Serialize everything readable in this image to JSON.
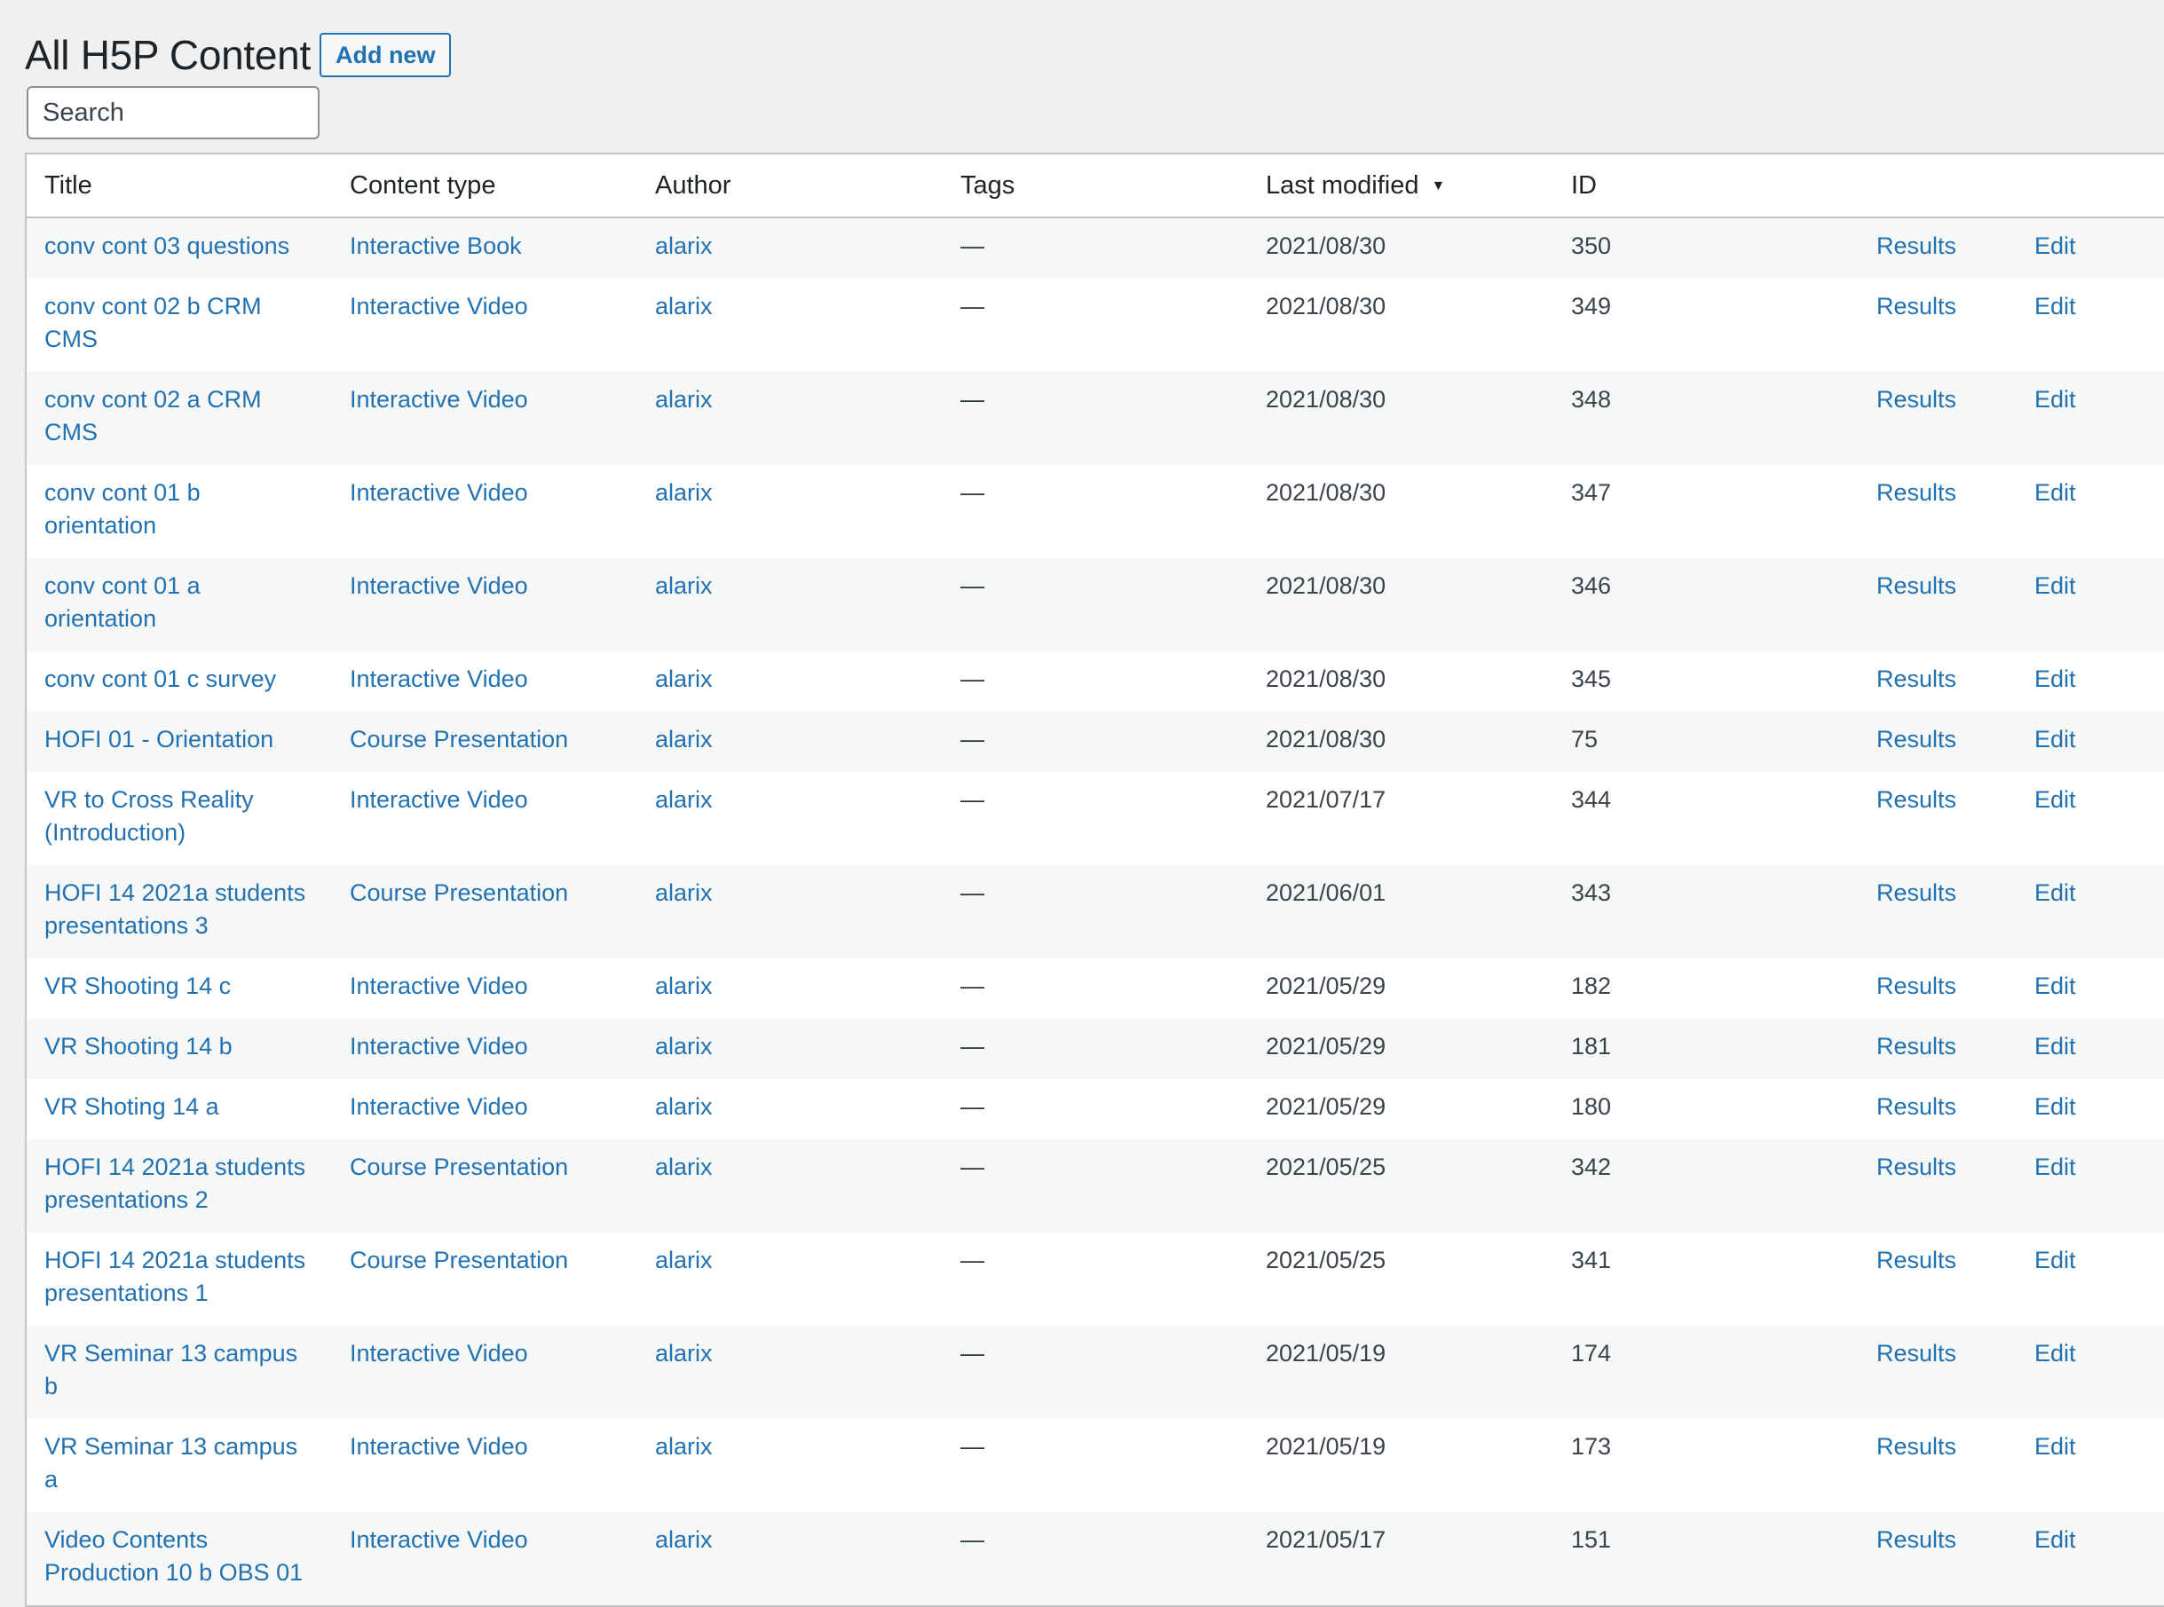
{
  "header": {
    "title": "All H5P Content",
    "add_new_label": "Add new"
  },
  "search": {
    "placeholder": "Search",
    "value": ""
  },
  "table": {
    "columns": [
      "Title",
      "Content type",
      "Author",
      "Tags",
      "Last modified",
      "ID",
      "",
      ""
    ],
    "sorted_column": "Last modified",
    "sort_direction": "descending",
    "rows": [
      {
        "title": "conv cont 03 questions",
        "type": "Interactive Book",
        "author": "alarix",
        "tags": "—",
        "modified": "2021/08/30",
        "id": "350",
        "results": "Results",
        "edit": "Edit"
      },
      {
        "title": "conv cont 02 b CRM CMS",
        "type": "Interactive Video",
        "author": "alarix",
        "tags": "—",
        "modified": "2021/08/30",
        "id": "349",
        "results": "Results",
        "edit": "Edit"
      },
      {
        "title": "conv cont 02 a CRM CMS",
        "type": "Interactive Video",
        "author": "alarix",
        "tags": "—",
        "modified": "2021/08/30",
        "id": "348",
        "results": "Results",
        "edit": "Edit"
      },
      {
        "title": "conv cont 01 b orientation",
        "type": "Interactive Video",
        "author": "alarix",
        "tags": "—",
        "modified": "2021/08/30",
        "id": "347",
        "results": "Results",
        "edit": "Edit"
      },
      {
        "title": "conv cont 01 a orientation",
        "type": "Interactive Video",
        "author": "alarix",
        "tags": "—",
        "modified": "2021/08/30",
        "id": "346",
        "results": "Results",
        "edit": "Edit"
      },
      {
        "title": "conv cont 01 c survey",
        "type": "Interactive Video",
        "author": "alarix",
        "tags": "—",
        "modified": "2021/08/30",
        "id": "345",
        "results": "Results",
        "edit": "Edit"
      },
      {
        "title": "HOFI 01 - Orientation",
        "type": "Course Presentation",
        "author": "alarix",
        "tags": "—",
        "modified": "2021/08/30",
        "id": "75",
        "results": "Results",
        "edit": "Edit"
      },
      {
        "title": "VR to Cross Reality (Introduction)",
        "type": "Interactive Video",
        "author": "alarix",
        "tags": "—",
        "modified": "2021/07/17",
        "id": "344",
        "results": "Results",
        "edit": "Edit"
      },
      {
        "title": "HOFI 14 2021a students presentations 3",
        "type": "Course Presentation",
        "author": "alarix",
        "tags": "—",
        "modified": "2021/06/01",
        "id": "343",
        "results": "Results",
        "edit": "Edit"
      },
      {
        "title": "VR Shooting 14 c",
        "type": "Interactive Video",
        "author": "alarix",
        "tags": "—",
        "modified": "2021/05/29",
        "id": "182",
        "results": "Results",
        "edit": "Edit"
      },
      {
        "title": "VR Shooting 14 b",
        "type": "Interactive Video",
        "author": "alarix",
        "tags": "—",
        "modified": "2021/05/29",
        "id": "181",
        "results": "Results",
        "edit": "Edit"
      },
      {
        "title": "VR Shoting 14 a",
        "type": "Interactive Video",
        "author": "alarix",
        "tags": "—",
        "modified": "2021/05/29",
        "id": "180",
        "results": "Results",
        "edit": "Edit"
      },
      {
        "title": "HOFI 14 2021a students presentations 2",
        "type": "Course Presentation",
        "author": "alarix",
        "tags": "—",
        "modified": "2021/05/25",
        "id": "342",
        "results": "Results",
        "edit": "Edit"
      },
      {
        "title": "HOFI 14 2021a students presentations 1",
        "type": "Course Presentation",
        "author": "alarix",
        "tags": "—",
        "modified": "2021/05/25",
        "id": "341",
        "results": "Results",
        "edit": "Edit"
      },
      {
        "title": "VR Seminar 13 campus b",
        "type": "Interactive Video",
        "author": "alarix",
        "tags": "—",
        "modified": "2021/05/19",
        "id": "174",
        "results": "Results",
        "edit": "Edit"
      },
      {
        "title": "VR Seminar 13 campus a",
        "type": "Interactive Video",
        "author": "alarix",
        "tags": "—",
        "modified": "2021/05/19",
        "id": "173",
        "results": "Results",
        "edit": "Edit"
      },
      {
        "title": "Video Contents Production 10 b OBS 01",
        "type": "Interactive Video",
        "author": "alarix",
        "tags": "—",
        "modified": "2021/05/17",
        "id": "151",
        "results": "Results",
        "edit": "Edit"
      }
    ]
  },
  "colors": {
    "link": "#2271b1",
    "background": "#f0f0f1",
    "row_alt": "#f6f7f7",
    "border": "#c3c4c7"
  },
  "icons": {
    "sort": "sort-down-icon"
  }
}
